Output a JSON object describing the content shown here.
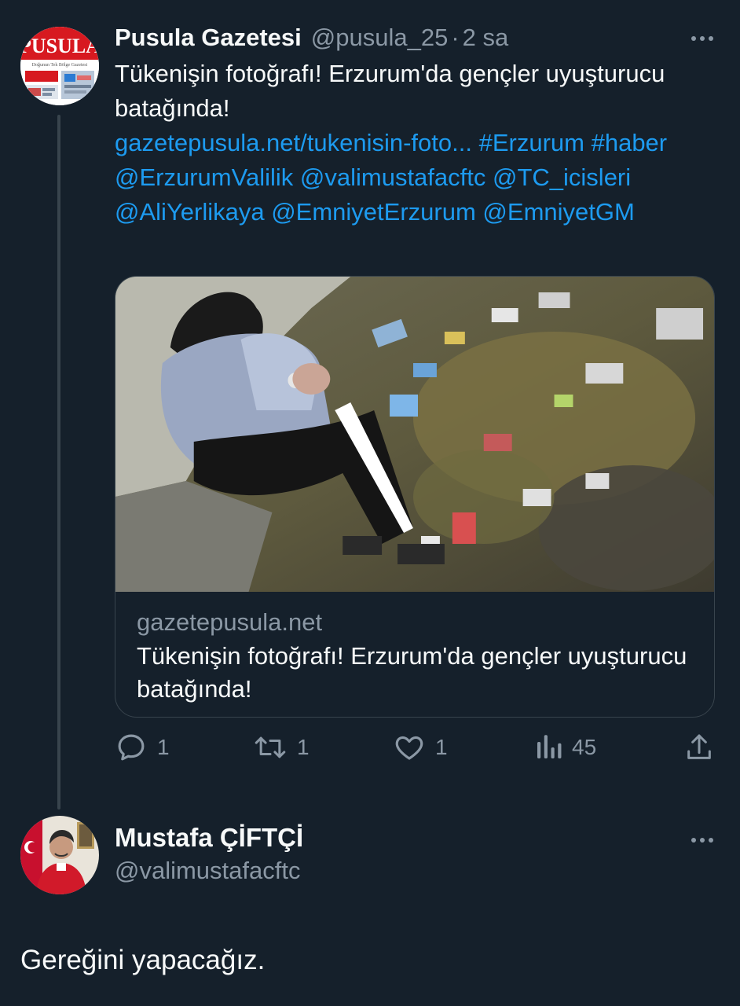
{
  "tweet": {
    "author_name": "Pusula Gazetesi",
    "author_handle": "@pusula_25",
    "separator": "·",
    "time": "2 sa",
    "avatar_logo_text": "PUSULA",
    "avatar_logo_tagline": "Doğunun Tek Bölge Gazetesi",
    "text": "Tükenişin fotoğrafı! Erzurum'da gençler uyuşturucu batağında!",
    "link": "gazetepusula.net/tukenisin-foto...",
    "hashtags": [
      "#Erzurum",
      "#haber"
    ],
    "mentions": [
      "@ErzurumValilik",
      "@valimustafacftc",
      "@TC_icisleri",
      "@AliYerlikaya",
      "@EmniyetErzurum",
      "@EmniyetGM"
    ],
    "card": {
      "domain": "gazetepusula.net",
      "title": "Tükenişin fotoğrafı! Erzurum'da gençler uyuşturucu batağında!"
    },
    "stats": {
      "replies": "1",
      "retweets": "1",
      "likes": "1",
      "views": "45"
    }
  },
  "reply": {
    "author_name": "Mustafa ÇİFTÇİ",
    "author_handle": "@valimustafacftc",
    "text": "Gereğini yapacağız."
  },
  "colors": {
    "background": "#15202b",
    "text": "#f7f9f9",
    "muted": "#8b98a5",
    "link": "#1d9bf0",
    "border": "#38444d"
  }
}
